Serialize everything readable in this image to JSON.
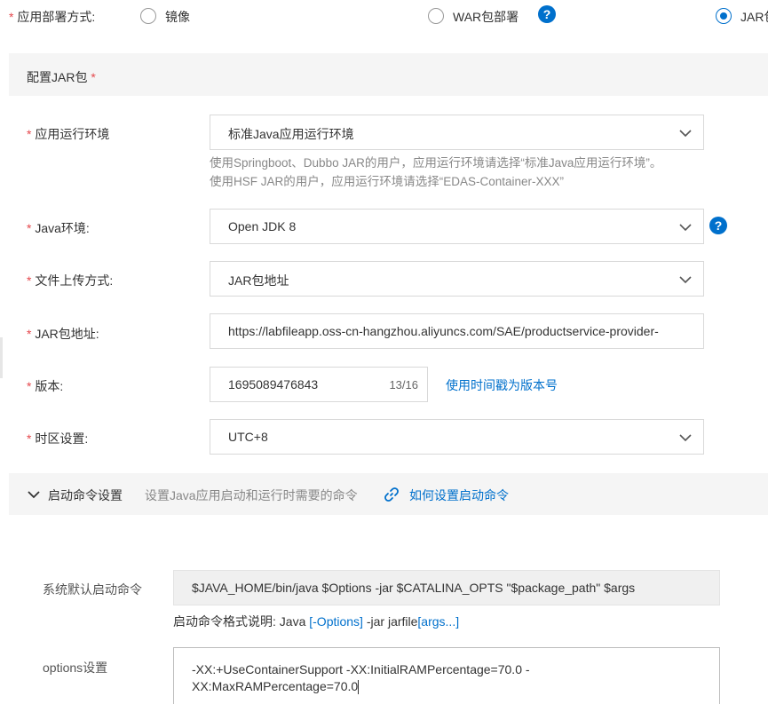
{
  "deploy": {
    "label": "应用部署方式:",
    "options": [
      {
        "label": "镜像",
        "selected": false
      },
      {
        "label": "WAR包部署",
        "selected": false
      },
      {
        "label": "JAR包",
        "selected": true
      }
    ],
    "help_icon": "question-circle-icon"
  },
  "section": {
    "title": "配置JAR包",
    "required_mark": "*"
  },
  "form": {
    "runtime": {
      "label": "应用运行环境",
      "value": "标准Java应用运行环境",
      "hint_line1": "使用Springboot、Dubbo JAR的用户，应用运行环境请选择“标准Java应用运行环境”。",
      "hint_line2": "使用HSF JAR的用户，应用运行环境请选择“EDAS-Container-XXX”"
    },
    "java_env": {
      "label": "Java环境:",
      "value": "Open JDK 8"
    },
    "upload": {
      "label": "文件上传方式:",
      "value": "JAR包地址"
    },
    "jar_url": {
      "label": "JAR包地址:",
      "value": "https://labfileapp.oss-cn-hangzhou.aliyuncs.com/SAE/productservice-provider-"
    },
    "version": {
      "label": "版本:",
      "value": "1695089476843",
      "counter": "13/16",
      "timestamp_link": "使用时间戳为版本号"
    },
    "timezone": {
      "label": "时区设置:",
      "value": "UTC+8"
    },
    "required_mark": "*"
  },
  "startup": {
    "title": "启动命令设置",
    "desc": "设置Java应用启动和运行时需要的命令",
    "howto_link": "如何设置启动命令",
    "default_label": "系统默认启动命令",
    "default_cmd": "$JAVA_HOME/bin/java $Options -jar $CATALINA_OPTS \"$package_path\" $args",
    "format_prefix": "启动命令格式说明:",
    "format_java": "Java",
    "format_options": "[-Options]",
    "format_jar": "-jar jarfile",
    "format_args": "[args...]",
    "options_label": "options设置",
    "options_line1": "-XX:+UseContainerSupport -XX:InitialRAMPercentage=70.0 -",
    "options_line2": "XX:MaxRAMPercentage=70.0"
  },
  "colors": {
    "accent": "#0070cc",
    "required": "#e5484d",
    "section_bg": "#f5f5f5"
  }
}
